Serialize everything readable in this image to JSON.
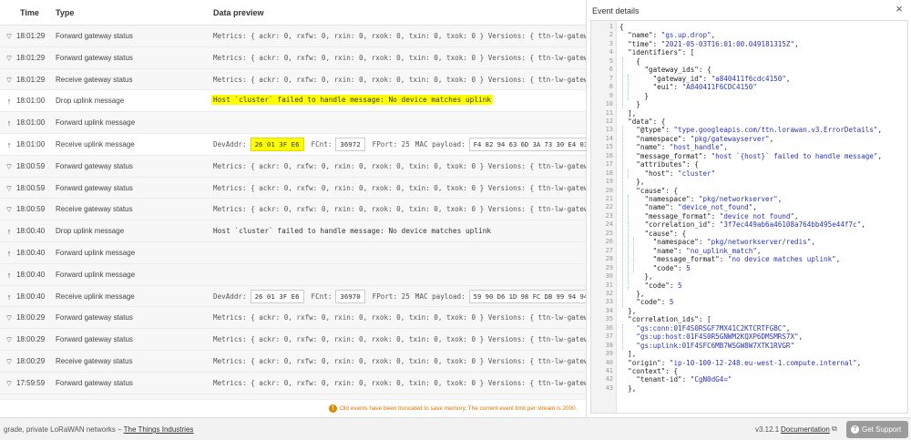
{
  "table": {
    "headers": {
      "time": "Time",
      "type": "Type",
      "preview": "Data preview"
    },
    "rows": [
      {
        "kind": "metrics",
        "icon": "gateway-icon",
        "time": "18:01:29",
        "type": "Forward gateway status",
        "preview": "Metrics: { ackr: 0, rxfw: 0, rxin: 0, rxok: 0, txin: 0, txok: 0 } Versions: { ttn-lw-gateway-se"
      },
      {
        "kind": "metrics",
        "icon": "gateway-icon",
        "time": "18:01:29",
        "type": "Forward gateway status",
        "preview": "Metrics: { ackr: 0, rxfw: 0, rxin: 0, rxok: 0, txin: 0, txok: 0 } Versions: { ttn-lw-gateway-se"
      },
      {
        "kind": "metrics",
        "icon": "gateway-icon",
        "time": "18:01:29",
        "type": "Receive gateway status",
        "preview": "Metrics: { ackr: 0, rxfw: 0, rxin: 0, rxok: 0, txin: 0, txok: 0 } Versions: { ttn-lw-gateway-se"
      },
      {
        "kind": "drop",
        "highlight": true,
        "icon": "arrow-up-icon",
        "time": "18:01:00",
        "type": "Drop uplink message",
        "preview": "Host `cluster` failed to handle message: No device matches uplink"
      },
      {
        "kind": "empty",
        "icon": "arrow-up-icon",
        "time": "18:01:00",
        "type": "Forward uplink message",
        "preview": ""
      },
      {
        "kind": "uplink",
        "highlight": true,
        "icon": "arrow-up-icon",
        "time": "18:01:00",
        "type": "Receive uplink message",
        "devaddr_label": "DevAddr:",
        "devaddr": "26 01 3F E6",
        "fcnt_label": "FCnt:",
        "fcnt": "36972",
        "fport": "FPort: 25",
        "mac_label": "MAC payload:",
        "payload": "F4 82 94 63 6D 3A 73 30 E4 03 E9 FB F8"
      },
      {
        "kind": "metrics",
        "icon": "gateway-icon",
        "time": "18:00:59",
        "type": "Forward gateway status",
        "preview": "Metrics: { ackr: 0, rxfw: 0, rxin: 0, rxok: 0, txin: 0, txok: 0 } Versions: { ttn-lw-gateway-se"
      },
      {
        "kind": "metrics",
        "icon": "gateway-icon",
        "time": "18:00:59",
        "type": "Forward gateway status",
        "preview": "Metrics: { ackr: 0, rxfw: 0, rxin: 0, rxok: 0, txin: 0, txok: 0 } Versions: { ttn-lw-gateway-se"
      },
      {
        "kind": "metrics",
        "icon": "gateway-icon",
        "time": "18:00:59",
        "type": "Receive gateway status",
        "preview": "Metrics: { ackr: 0, rxfw: 0, rxin: 0, rxok: 0, txin: 0, txok: 0 } Versions: { ttn-lw-gateway-se"
      },
      {
        "kind": "drop",
        "highlight": false,
        "icon": "arrow-up-icon",
        "time": "18:00:40",
        "type": "Drop uplink message",
        "preview": "Host `cluster` failed to handle message: No device matches uplink"
      },
      {
        "kind": "empty",
        "icon": "arrow-up-icon",
        "time": "18:00:40",
        "type": "Forward uplink message",
        "preview": ""
      },
      {
        "kind": "empty",
        "icon": "arrow-up-icon",
        "time": "18:00:40",
        "type": "Forward uplink message",
        "preview": ""
      },
      {
        "kind": "uplink",
        "highlight": false,
        "icon": "arrow-up-icon",
        "time": "18:00:40",
        "type": "Receive uplink message",
        "devaddr_label": "DevAddr:",
        "devaddr": "26 01 3F E6",
        "fcnt_label": "FCnt:",
        "fcnt": "36970",
        "fport": "FPort: 25",
        "mac_label": "MAC payload:",
        "payload": "59 90 D6 1D 98 FC DB 99 94 94 BB F2 18"
      },
      {
        "kind": "metrics",
        "icon": "gateway-icon",
        "time": "18:00:29",
        "type": "Forward gateway status",
        "preview": "Metrics: { ackr: 0, rxfw: 0, rxin: 0, rxok: 0, txin: 0, txok: 0 } Versions: { ttn-lw-gateway-se"
      },
      {
        "kind": "metrics",
        "icon": "gateway-icon",
        "time": "18:00:29",
        "type": "Forward gateway status",
        "preview": "Metrics: { ackr: 0, rxfw: 0, rxin: 0, rxok: 0, txin: 0, txok: 0 } Versions: { ttn-lw-gateway-se"
      },
      {
        "kind": "metrics",
        "icon": "gateway-icon",
        "time": "18:00:29",
        "type": "Receive gateway status",
        "preview": "Metrics: { ackr: 0, rxfw: 0, rxin: 0, rxok: 0, txin: 0, txok: 0 } Versions: { ttn-lw-gateway-se"
      },
      {
        "kind": "metrics",
        "icon": "gateway-icon",
        "time": "17:59:59",
        "type": "Forward gateway status",
        "preview": "Metrics: { ackr: 0, rxfw: 0, rxin: 0, rxok: 0, txin: 0, txok: 0 } Versions: { ttn-lw-gateway-se"
      },
      {
        "kind": "metrics",
        "icon": "gateway-icon",
        "time": "17:59:59",
        "type": "Forward gateway status",
        "preview": "Metrics: { ackr: 0, rxfw: 0, rxin: 0, rxok: 0, txin: 0, txok: 0 } Versions: { ttn-lw-gateway-se"
      }
    ]
  },
  "truncation": {
    "icon": "warning-icon",
    "message": "Old events have been truncated to save memory. The current event limit per stream is 2000."
  },
  "panel": {
    "title": "Event details",
    "close_icon": "close-icon",
    "lines": [
      "{",
      "  \"name\": \"gs.up.drop\",",
      "  \"time\": \"2021-05-03T16:01:00.049181315Z\",",
      "  \"identifiers\": [",
      "    {",
      "      \"gateway_ids\": {",
      "        \"gateway_id\": \"a840411f6cdc4150\",",
      "        \"eui\": \"A840411F6CDC4150\"",
      "      }",
      "    }",
      "  ],",
      "  \"data\": {",
      "    \"@type\": \"type.googleapis.com/ttn.lorawan.v3.ErrorDetails\",",
      "    \"namespace\": \"pkg/gatewayserver\",",
      "    \"name\": \"host_handle\",",
      "    \"message_format\": \"host `{host}` failed to handle message\",",
      "    \"attributes\": {",
      "      \"host\": \"cluster\"",
      "    },",
      "    \"cause\": {",
      "      \"namespace\": \"pkg/networkserver\",",
      "      \"name\": \"device_not_found\",",
      "      \"message_format\": \"device not found\",",
      "      \"correlation_id\": \"3f7ec449ab6a46108a764bb495e44f7c\",",
      "      \"cause\": {",
      "        \"namespace\": \"pkg/networkserver/redis\",",
      "        \"name\": \"no_uplink_match\",",
      "        \"message_format\": \"no device matches uplink\",",
      "        \"code\": 5",
      "      },",
      "      \"code\": 5",
      "    },",
      "    \"code\": 5",
      "  },",
      "  \"correlation_ids\": [",
      "    \"gs:conn:01F4S0RSGF7MX41C2KTCRTFGBC\",",
      "    \"gs:up:host:01F4S0R5GNWM2KQXP6DMSMRS7X\",",
      "    \"gs:uplink:01F4SFC6MB7WSGW8W7XTK1RVGR\"",
      "  ],",
      "  \"origin\": \"ip-10-100-12-248.eu-west-1.compute.internal\",",
      "  \"context\": {",
      "    \"tenant-id\": \"CgN0dG4=\"",
      "  },"
    ]
  },
  "footer": {
    "left_text": "grade, private LoRaWAN networks – ",
    "company_link": "The Things Industries",
    "version": "v3.12.1",
    "documentation": "Documentation",
    "doc_icon": "external-link-icon",
    "support": "Get Support",
    "support_icon": "question-icon"
  },
  "colors": {
    "highlight": "#ffff00",
    "warning": "#e07000",
    "json_string": "#2a36b1",
    "support_button": "#9b9b9b"
  }
}
